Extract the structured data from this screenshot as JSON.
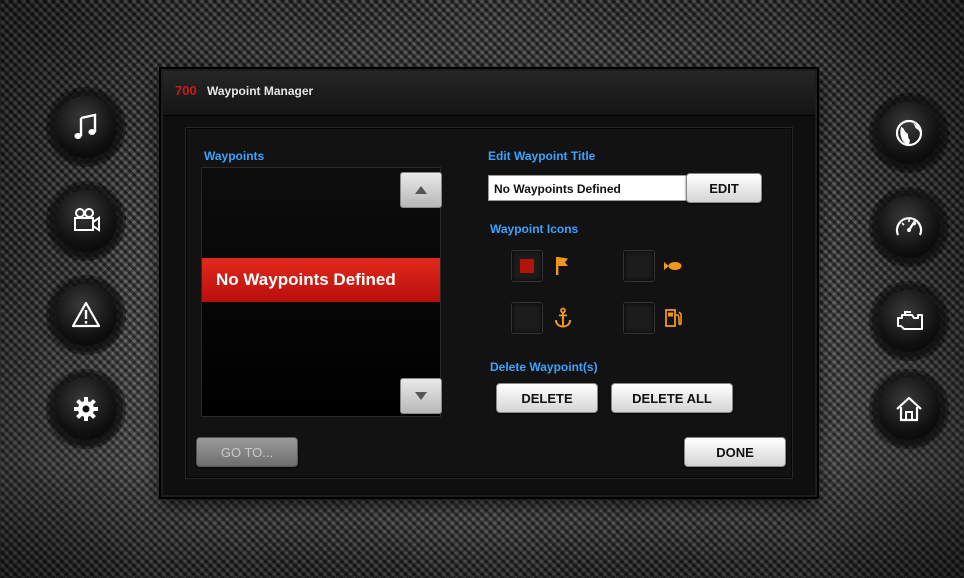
{
  "window": {
    "title_number": "700",
    "title": "Waypoint Manager"
  },
  "waypoints": {
    "label": "Waypoints",
    "items": [
      "No Waypoints Defined"
    ]
  },
  "edit": {
    "label": "Edit Waypoint Title",
    "field_value": "No Waypoints Defined",
    "edit_button": "EDIT"
  },
  "icons": {
    "label": "Waypoint Icons",
    "options": [
      {
        "icon": "flag-icon",
        "checked": true
      },
      {
        "icon": "fish-icon",
        "checked": false
      },
      {
        "icon": "anchor-icon",
        "checked": false
      },
      {
        "icon": "fuel-pump-icon",
        "checked": false
      }
    ]
  },
  "delete": {
    "label": "Delete Waypoint(s)",
    "delete_button": "DELETE",
    "delete_all_button": "DELETE ALL"
  },
  "footer": {
    "goto_button": "GO TO...",
    "done_button": "DONE"
  },
  "side_nav": {
    "left": [
      "music-icon",
      "video-camera-icon",
      "warning-icon",
      "settings-gear-icon"
    ],
    "right": [
      "globe-icon",
      "speedometer-icon",
      "engine-icon",
      "home-icon"
    ]
  },
  "colors": {
    "accent_blue": "#3aa3ff",
    "highlight_red": "#d8201a",
    "icon_orange": "#f2961e"
  }
}
